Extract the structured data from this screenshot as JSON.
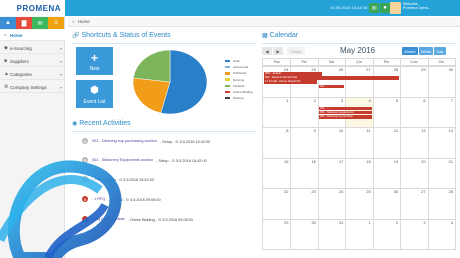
{
  "app": {
    "logo": "PROMENA",
    "datetime": "04.05.2016 15:44:08",
    "welcome_line1": "Welcome,",
    "welcome_line2": "Promena Opera..."
  },
  "topbar_icons": [
    {
      "name": "message-icon",
      "glyph": "✉",
      "color": "#3aa655",
      "badge": "0"
    },
    {
      "name": "bell-icon",
      "glyph": "●",
      "color": "#3aa655",
      "badge": ""
    }
  ],
  "sidebar": {
    "shortcuts": [
      {
        "name": "user-icon",
        "glyph": "▲",
        "color": "#3a8fd6"
      },
      {
        "name": "chart-icon",
        "glyph": "▇",
        "color": "#e64b3b"
      },
      {
        "name": "mail-icon",
        "glyph": "✉",
        "color": "#3bb75c"
      },
      {
        "name": "list-icon",
        "glyph": "≡",
        "color": "#f0a10e"
      }
    ],
    "items": [
      {
        "label": "Home",
        "icon": "⌂"
      },
      {
        "label": "e-Sourcing",
        "icon": "◆"
      },
      {
        "label": "Suppliers",
        "icon": "■"
      },
      {
        "label": "Categories",
        "icon": "▲"
      },
      {
        "label": "Company Settings",
        "icon": "⚙"
      }
    ]
  },
  "breadcrumb": {
    "label": "Home"
  },
  "shortcuts": {
    "title": "Shortcuts & Status of Events",
    "new_label": "New",
    "event_list_label": "Event List",
    "legend": [
      {
        "label": "Draft",
        "color": "#2a7fc9"
      },
      {
        "label": "Announced",
        "color": "#7fb6e0"
      },
      {
        "label": "Published",
        "color": "#f29d1a"
      },
      {
        "label": "Running",
        "color": "#e7ce3a"
      },
      {
        "label": "Finished",
        "color": "#7cb55a"
      },
      {
        "label": "Online Bidding",
        "color": "#c53b2e"
      },
      {
        "label": "Passive",
        "color": "#3d3d3d"
      }
    ]
  },
  "chart_data": {
    "type": "pie",
    "slices": [
      {
        "label": "Draft",
        "value": 54,
        "color": "#2a7fc9"
      },
      {
        "label": "Published",
        "value": 23,
        "color": "#f29d1a"
      },
      {
        "label": "Finished",
        "value": 23,
        "color": "#7cb55a"
      }
    ]
  },
  "activities": {
    "title": "Recent Activities",
    "items": [
      {
        "title": "003 - Cleaning sup purchasing auction",
        "meta": "- Setup - ⊙ 5.5.2016 15:42:00"
      },
      {
        "title": "002 - Stationery Equipments auction",
        "meta": "- Setup - ⊙ 5.5.2016 15:42:00"
      },
      {
        "title": "...ent",
        "meta": "- Setup - ⊙ 5.5.2016 15:42:00"
      },
      {
        "title": "...t RFQ",
        "meta": "- Closed - ⊙ 4.5.2016 09:06:00"
      },
      {
        "title": "...ing 010016 sifiale",
        "meta": "- Online Bidding - ⊙ 5.5.2016 09:06:00"
      }
    ]
  },
  "calendar": {
    "title": "Calendar",
    "month_label": "May 2016",
    "today_label": "Today",
    "views": [
      "Month",
      "Week",
      "Day"
    ],
    "day_headers": [
      "Paz",
      "Pzt",
      "Sal",
      "Çar",
      "Per",
      "Cum",
      "Cts"
    ],
    "weeks": [
      [
        "1",
        "2",
        "3",
        "4",
        "5",
        "6",
        "7"
      ],
      [
        "8",
        "9",
        "10",
        "11",
        "12",
        "13",
        "14"
      ],
      [
        "15",
        "16",
        "17",
        "18",
        "19",
        "20",
        "21"
      ],
      [
        "22",
        "23",
        "24",
        "25",
        "26",
        "27",
        "28"
      ],
      [
        "29",
        "30",
        "31",
        "1",
        "2",
        "3",
        "4"
      ]
    ],
    "prev_week": [
      "24",
      "25",
      "26",
      "27",
      "28",
      "29",
      "30"
    ],
    "events": [
      {
        "label": "#RR - default",
        "color": "#c53b2e"
      },
      {
        "label": "002 - Setup Preferred Files",
        "color": "#c53b2e"
      },
      {
        "label": "17:14 ddd - Dance dinquid 33",
        "color": "#c53b2e"
      },
      {
        "label": "001 - ...",
        "color": "#c53b2e"
      },
      {
        "label": "001 - ...",
        "color": "#c53b2e"
      },
      {
        "label": "002 - Stationery Equipments",
        "color": "#c53b2e"
      },
      {
        "label": "003 - Cleaning sup purchas",
        "color": "#c53b2e"
      }
    ]
  }
}
